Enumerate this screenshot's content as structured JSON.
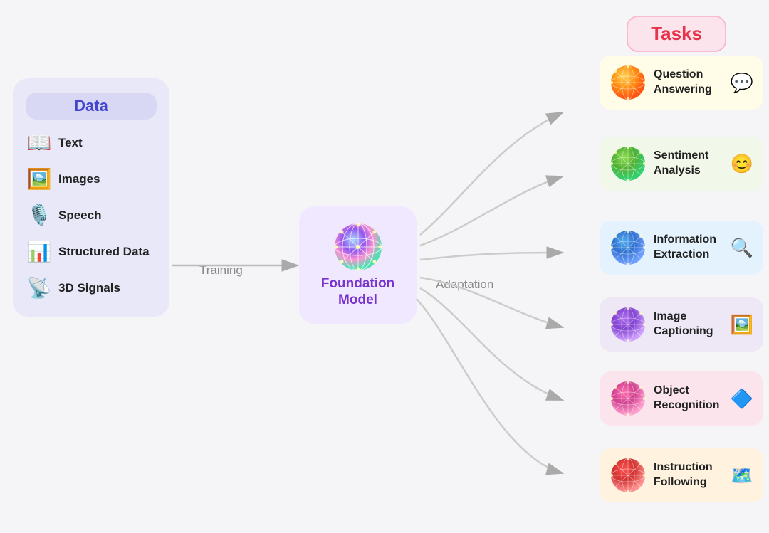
{
  "data_panel": {
    "title": "Data",
    "items": [
      {
        "label": "Text",
        "icon": "📖"
      },
      {
        "label": "Images",
        "icon": "🖼️"
      },
      {
        "label": "Speech",
        "icon": "🎙️"
      },
      {
        "label": "Structured Data",
        "icon": "📊"
      },
      {
        "label": "3D Signals",
        "icon": "📡"
      }
    ]
  },
  "training_label": "Training",
  "foundation_model": {
    "label": "Foundation\nModel"
  },
  "adaptation_label": "Adaptation",
  "tasks_title": "Tasks",
  "tasks": [
    {
      "label": "Question\nAnswering",
      "icon": "💬",
      "bg": "#fffde7",
      "sphere_color": "#e8a020"
    },
    {
      "label": "Sentiment\nAnalysis",
      "icon": "😊",
      "bg": "#f1f8e9",
      "sphere_color": "#66bb6a"
    },
    {
      "label": "Information\nExtraction",
      "icon": "🔍",
      "bg": "#e3f2fd",
      "sphere_color": "#5c9fd4"
    },
    {
      "label": "Image\nCaptioning",
      "icon": "🖼️",
      "bg": "#ede7f6",
      "sphere_color": "#9575cd"
    },
    {
      "label": "Object\nRecognition",
      "icon": "🔷",
      "bg": "#fce4ec",
      "sphere_color": "#e879a0"
    },
    {
      "label": "Instruction\nFollowing",
      "icon": "🗺️",
      "bg": "#fff3e0",
      "sphere_color": "#e85050"
    }
  ]
}
